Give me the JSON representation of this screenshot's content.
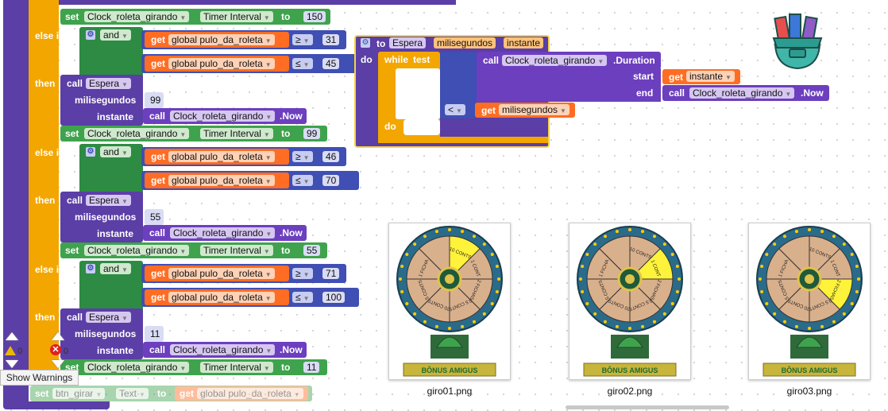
{
  "top_set": {
    "set": "set",
    "component": "Clock_roleta_girando",
    "prop": "Timer Interval",
    "to": "to",
    "value": "150"
  },
  "branches": [
    {
      "kw": "else if",
      "and": "and",
      "var1": "global pulo_da_roleta",
      "op1": "≥",
      "n1": "31",
      "var2": "global pulo_da_roleta",
      "op2": "≤",
      "n2": "45",
      "then": "then",
      "call": "call",
      "proc": "Espera",
      "p1": "milisegundos",
      "v1": "99",
      "p2": "instante",
      "c_call": "call",
      "c_comp": "Clock_roleta_girando",
      "c_method": ".Now",
      "set": "set",
      "s_comp": "Clock_roleta_girando",
      "s_prop": "Timer Interval",
      "s_to": "to",
      "s_val": "99",
      "get": "get"
    },
    {
      "kw": "else if",
      "and": "and",
      "var1": "global pulo_da_roleta",
      "op1": "≥",
      "n1": "46",
      "var2": "global pulo_da_roleta",
      "op2": "≤",
      "n2": "70",
      "then": "then",
      "call": "call",
      "proc": "Espera",
      "p1": "milisegundos",
      "v1": "55",
      "p2": "instante",
      "c_call": "call",
      "c_comp": "Clock_roleta_girando",
      "c_method": ".Now",
      "set": "set",
      "s_comp": "Clock_roleta_girando",
      "s_prop": "Timer Interval",
      "s_to": "to",
      "s_val": "55",
      "get": "get"
    },
    {
      "kw": "else if",
      "and": "and",
      "var1": "global pulo_da_roleta",
      "op1": "≥",
      "n1": "71",
      "var2": "global pulo_da_roleta",
      "op2": "≤",
      "n2": "100",
      "then": "then",
      "call": "call",
      "proc": "Espera",
      "p1": "milisegundos",
      "v1": "11",
      "p2": "instante",
      "c_call": "call",
      "c_comp": "Clock_roleta_girando",
      "c_method": ".Now",
      "set": "set",
      "s_comp": "Clock_roleta_girando",
      "s_prop": "Timer Interval",
      "s_to": "to",
      "s_val": "11",
      "get": "get"
    }
  ],
  "bottom_set": {
    "set": "set",
    "component": "btn_girar",
    "prop": "Text",
    "to": "to",
    "get": "get",
    "var": "global pulo_da_roleta"
  },
  "procedure": {
    "to": "to",
    "name": "Espera",
    "param1": "milisegundos",
    "param2": "instante",
    "do": "do",
    "while": "while",
    "test": "test",
    "call": "call",
    "comp": "Clock_roleta_girando",
    "method": ".Duration",
    "start": "start",
    "get_instante": "get",
    "instante": "instante",
    "end": "end",
    "end_call": "call",
    "end_comp": "Clock_roleta_girando",
    "end_method": ".Now",
    "lt": "<",
    "get_ms": "get",
    "ms": "milisegundos",
    "do2": "do"
  },
  "warnings": {
    "warn_count": "0",
    "error_count": "0",
    "show_warnings": "Show Warnings"
  },
  "images": [
    {
      "caption": "giro01.png",
      "highlight": 0
    },
    {
      "caption": "giro02.png",
      "highlight": 1
    },
    {
      "caption": "giro03.png",
      "highlight": 2
    }
  ],
  "wheel": {
    "segments": [
      "10 CONTS",
      "1 CONT",
      "2 FICHAS",
      "0.5 CONTS",
      "20 CONTS",
      "5 CONTS",
      "1 FICHA"
    ],
    "banner": "BÔNUS AMIGUS"
  },
  "colors": {
    "ctrl": "#f3a600",
    "logic": "#2e8b44",
    "math": "#3f4fb3",
    "var": "#ff6d24",
    "proc": "#5b3ea6",
    "component": "#3fa34d",
    "highlight": "#fff23a"
  },
  "icons": [
    "gear-icon",
    "warning-icon",
    "error-icon",
    "backpack-icon",
    "chevron-up-icon",
    "chevron-down-icon"
  ]
}
